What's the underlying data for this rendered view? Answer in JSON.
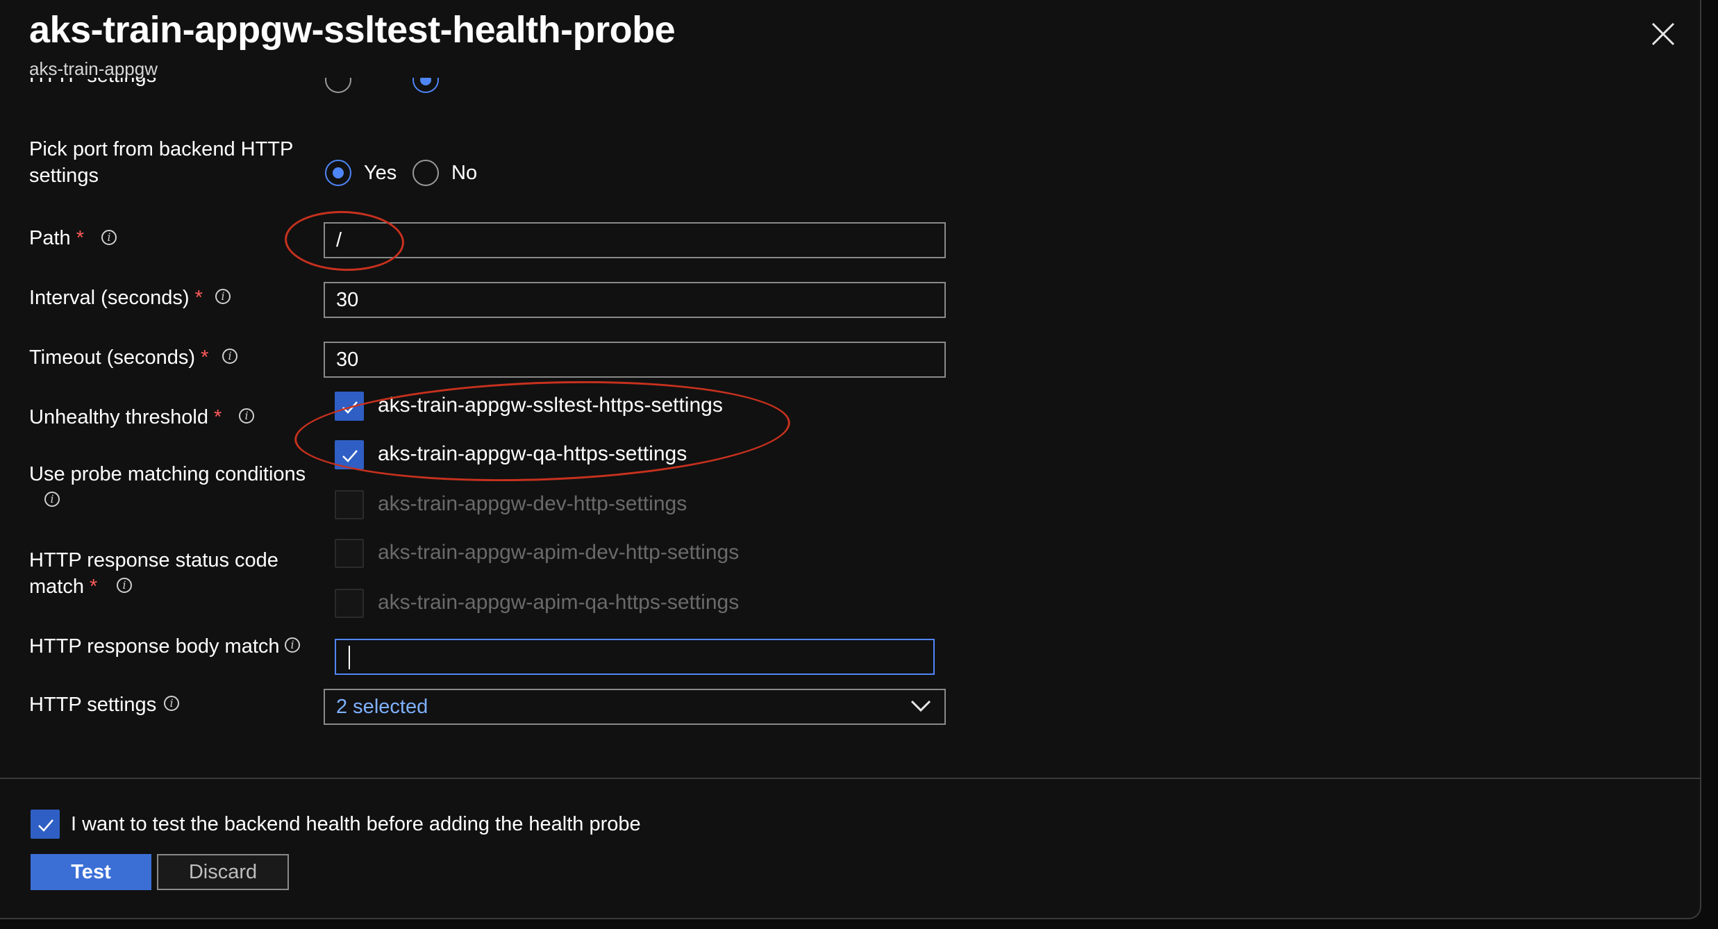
{
  "header": {
    "title": "aks-train-appgw-ssltest-health-probe",
    "subtitle": "aks-train-appgw",
    "partial_label": "HTTP settings"
  },
  "form": {
    "pick_port": {
      "label": "Pick port from backend HTTP settings",
      "yes": "Yes",
      "no": "No",
      "selected": "Yes"
    },
    "path": {
      "label": "Path",
      "value": "/"
    },
    "interval": {
      "label": "Interval (seconds)",
      "value": "30"
    },
    "timeout": {
      "label": "Timeout (seconds)",
      "value": "30"
    },
    "unhealthy_threshold": {
      "label": "Unhealthy threshold"
    },
    "probe_matching": {
      "label": "Use probe matching conditions"
    },
    "status_code_match": {
      "label_line1": "HTTP response status code",
      "label_line2": "match"
    },
    "body_match": {
      "label": "HTTP response body match",
      "value": ""
    },
    "http_settings": {
      "label": "HTTP settings",
      "value": "2 selected"
    },
    "required_marker": "*"
  },
  "dropdown_options": [
    {
      "label": "aks-train-appgw-ssltest-https-settings",
      "checked": true,
      "enabled": true
    },
    {
      "label": "aks-train-appgw-qa-https-settings",
      "checked": true,
      "enabled": true
    },
    {
      "label": "aks-train-appgw-dev-http-settings",
      "checked": false,
      "enabled": false
    },
    {
      "label": "aks-train-appgw-apim-dev-http-settings",
      "checked": false,
      "enabled": false
    },
    {
      "label": "aks-train-appgw-apim-qa-https-settings",
      "checked": false,
      "enabled": false
    }
  ],
  "footer": {
    "test_checkbox_label": "I want to test the backend health before adding the health probe",
    "test_checkbox_checked": true,
    "test_button": "Test",
    "discard_button": "Discard"
  },
  "colors": {
    "background": "#111111",
    "accent": "#3b6fd6",
    "annotation": "#c8311e",
    "required": "#ff5a5a"
  }
}
